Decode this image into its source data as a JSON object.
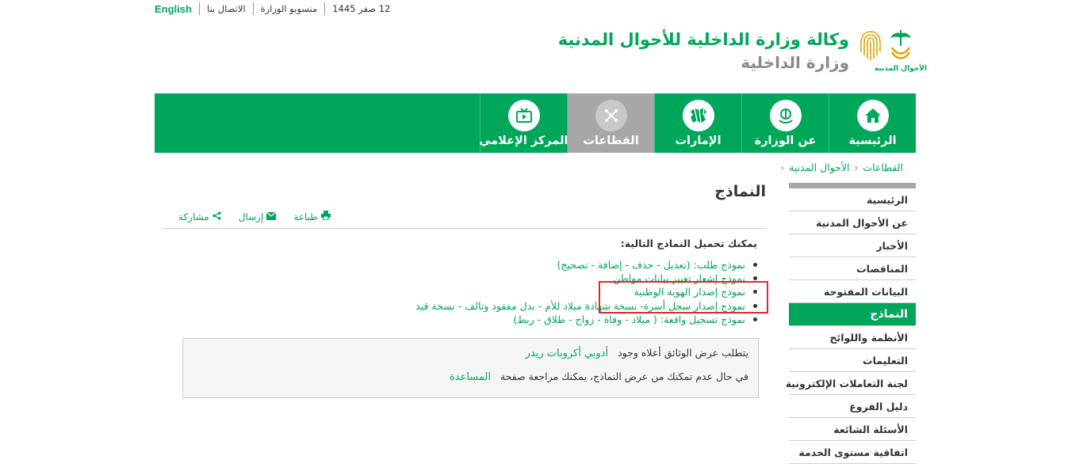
{
  "topbar": {
    "date": "12 صفر 1445",
    "staff": "منسوبو الوزارة",
    "contact": "الاتصال بنا",
    "english": "English"
  },
  "header": {
    "title": "وكالة وزارة الداخلية للأحوال المدنية",
    "subtitle": "وزارة الداخلية",
    "emblem_caption": "الأحوال المدنية"
  },
  "nav": {
    "items": [
      {
        "label": "الرئيسية",
        "icon": "home-icon"
      },
      {
        "label": "عن الوزارة",
        "icon": "ministry-emblem-icon"
      },
      {
        "label": "الإمارات",
        "icon": "map-icon"
      },
      {
        "label": "القطاعات",
        "icon": "share-nodes-icon"
      },
      {
        "label": "المركز الإعلامي",
        "icon": "tv-icon"
      }
    ]
  },
  "breadcrumb": {
    "items": [
      "الأحوال المدنية",
      "القطاعات"
    ]
  },
  "sidebar": {
    "items": [
      "الرئيسية",
      "عن الأحوال المدنية",
      "الأخبار",
      "المناقصات",
      "البيانات المفتوحة",
      "النماذج",
      "الأنظمة واللوائح",
      "التعليمات",
      "لجنة التعاملات الإلكترونية",
      "دليل الفروع",
      "الأسئلة الشائعة",
      "اتفاقية مستوى الخدمة"
    ]
  },
  "content": {
    "title": "النماذج",
    "tools": {
      "print": "طباعة",
      "send": "إرسال",
      "share": "مشاركة"
    },
    "intro": "يمكنك تحميل النماذج التالية:",
    "forms": [
      "نموذج طلب: (تعديل - حذف - إضافة - تصحيح)",
      "نموذج إشعار تغيير بيانات مواطن",
      "نموذج إصدار الهوية الوطنية",
      "نموذج إصدار سجل أسرة- نسخة شهادة ميلاد للأم - بدل مفقود وتالف - نسخة قيد",
      "نموذج تسجيل واقعة: ( ميلاد - وفاة - زواج - طلاق - ربط)"
    ],
    "notice": {
      "line1": "يتطلب عرض الوثائق أعلاه وجود",
      "line1_link": "أدوبي أكروبات ريدر",
      "line2": "في حال عدم تمكنك من عرض النماذج، يمكنك مراجعة صفحة",
      "line2_link": "المساعدة"
    }
  },
  "colors": {
    "brand": "#00a65a",
    "active_nav": "#a7a7a7",
    "highlight": "#e2262c"
  }
}
